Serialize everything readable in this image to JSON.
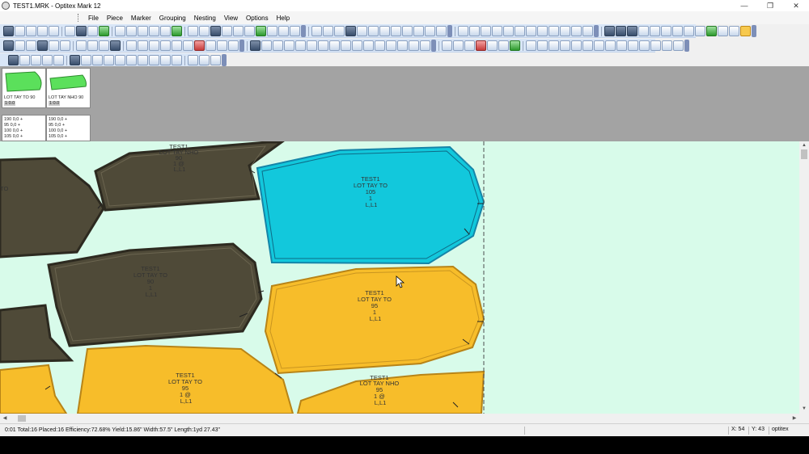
{
  "window": {
    "title": "TEST1.MRK - Optitex Mark 12",
    "minimize": "—",
    "restore": "❐",
    "close": "✕"
  },
  "menu": [
    "File",
    "Piece",
    "Marker",
    "Grouping",
    "Nesting",
    "View",
    "Options",
    "Help"
  ],
  "piece_panel": {
    "cards": [
      {
        "name": "LOT TAY TO 90",
        "value": "1:0.0"
      },
      {
        "name": "LOT TAY NHO 90",
        "value": "1:0.0"
      }
    ],
    "size_lists": [
      [
        "190  0,0 +",
        " 95  0,0 +",
        " 100 0,0 +",
        " 105 0,0 +"
      ],
      [
        "190  0,0 +",
        " 95  0,0 +",
        " 100 0,0 +",
        " 105 0,0 +"
      ]
    ]
  },
  "pieces": [
    {
      "lines": [
        "TEST1",
        "LOT TAY NHO",
        "90",
        "1 @",
        "L,L1"
      ]
    },
    {
      "lines": [
        "TO"
      ]
    },
    {
      "lines": [
        "TEST1",
        "LOT TAY TO",
        "105",
        "1",
        "L,L1"
      ]
    },
    {
      "lines": [
        "TEST1",
        "LOT TAY TO",
        "90",
        "1",
        "L,L1"
      ]
    },
    {
      "lines": [
        "TEST1",
        "LOT TAY TO",
        "95",
        "1",
        "L,L1"
      ]
    },
    {
      "lines": [
        "TEST1",
        "LOT TAY TO",
        "95",
        "1 @",
        "L,L1"
      ]
    },
    {
      "lines": [
        "TEST1",
        "LOT TAY NHO",
        "95",
        "1 @",
        "L,L1"
      ]
    }
  ],
  "colors": {
    "dark_piece": "#4f4a38",
    "selected_piece": "#12c8dc",
    "yellow_piece": "#f7bd2a",
    "marker_bg": "#d8fbea",
    "toolbar_bg": "#d9e6f7"
  },
  "status": {
    "text": "0:01  Total:16  Placed:16  Efficiency:72.68%  Yield:15.86\"  Width:57.5\"  Length:1yd 27.43\"",
    "x": "X: 54",
    "y": "Y: 43",
    "brand": "optitex"
  }
}
